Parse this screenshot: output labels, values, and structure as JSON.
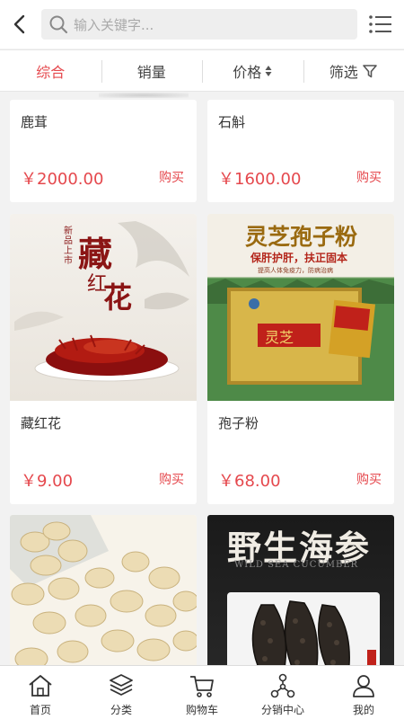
{
  "search": {
    "placeholder": "输入关键字..."
  },
  "filters": [
    {
      "label": "综合"
    },
    {
      "label": "销量"
    },
    {
      "label": "价格"
    },
    {
      "label": "筛选"
    }
  ],
  "products": [
    {
      "name": "鹿茸",
      "price": "￥2000.00",
      "buy": "购买"
    },
    {
      "name": "石斛",
      "price": "￥1600.00",
      "buy": "购买"
    },
    {
      "name": "藏红花",
      "price": "￥9.00",
      "buy": "购买",
      "image_text": {
        "title": "藏",
        "title2": "红",
        "title3": "花",
        "badge": "新品上市"
      }
    },
    {
      "name": "孢子粉",
      "price": "￥68.00",
      "buy": "购买",
      "image_text": {
        "headline": "灵芝孢子粉",
        "sub1": "保肝护肝，扶正固本",
        "sub2": "提高人体免疫力，防病治病",
        "box": "灵芝"
      }
    },
    {
      "name": "",
      "price": "",
      "buy": ""
    },
    {
      "name": "",
      "price": "",
      "buy": "",
      "image_text": {
        "headline": "野生海参",
        "sub": "WILD SEA CUCUMBER"
      }
    }
  ],
  "tabbar": [
    {
      "label": "首页",
      "icon": "home-icon"
    },
    {
      "label": "分类",
      "icon": "layers-icon"
    },
    {
      "label": "购物车",
      "icon": "cart-icon"
    },
    {
      "label": "分销中心",
      "icon": "network-icon"
    },
    {
      "label": "我的",
      "icon": "user-icon"
    }
  ],
  "colors": {
    "accent": "#e5484d",
    "background": "#f2f2f2"
  }
}
